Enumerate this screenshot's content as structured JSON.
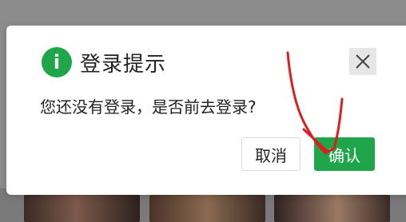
{
  "dialog": {
    "title": "登录提示",
    "info_icon_glyph": "i",
    "info_icon_color": "#1fa64b",
    "message": "您还没有登录，是否前去登录?",
    "cancel_label": "取消",
    "confirm_label": "确认",
    "accent_color": "#1fa64b"
  },
  "icons": {
    "info": "info-icon",
    "close": "close-icon"
  }
}
